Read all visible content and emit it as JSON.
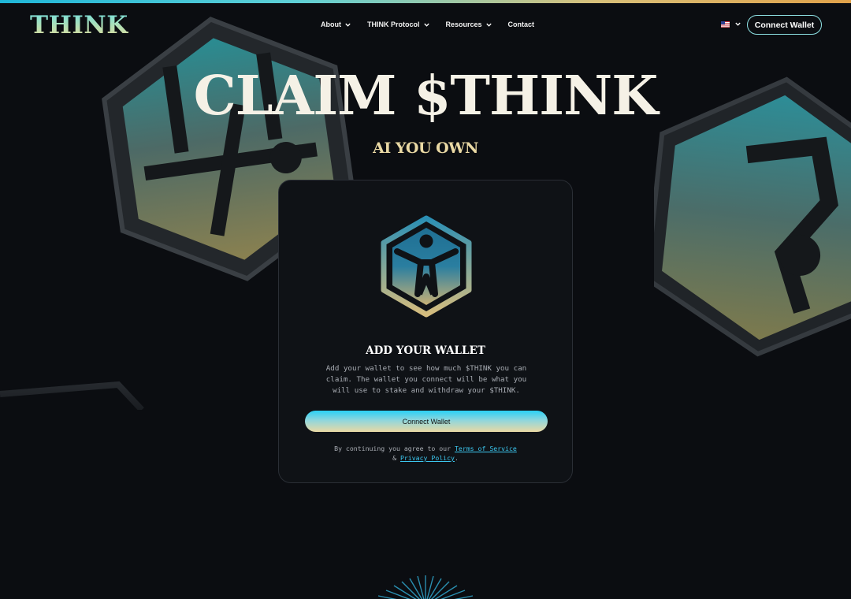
{
  "header": {
    "logo": "THINK",
    "nav": [
      {
        "label": "About",
        "has_dropdown": true
      },
      {
        "label": "THINK Protocol",
        "has_dropdown": true
      },
      {
        "label": "Resources",
        "has_dropdown": true
      },
      {
        "label": "Contact",
        "has_dropdown": false
      }
    ],
    "language_icon": "us-flag-icon",
    "connect_label": "Connect Wallet"
  },
  "hero": {
    "title": "CLAIM $THINK",
    "subtitle": "AI YOU OWN"
  },
  "card": {
    "logo_icon": "think-hexagon-person-icon",
    "title": "ADD YOUR WALLET",
    "description": "Add your wallet to see how much $THINK you can claim. The wallet you connect will be what you will use to stake and withdraw your $THINK.",
    "connect_label": "Connect Wallet",
    "legal_prefix": "By continuing you agree to our",
    "terms_label": "Terms of Service",
    "legal_join": "&",
    "privacy_label": "Privacy Policy",
    "legal_suffix": "."
  },
  "colors": {
    "accent_cyan": "#2ad0f5",
    "accent_gold": "#ead9a4",
    "background": "#0b0d11",
    "card": "#0f1216",
    "link": "#3cc7ef"
  }
}
